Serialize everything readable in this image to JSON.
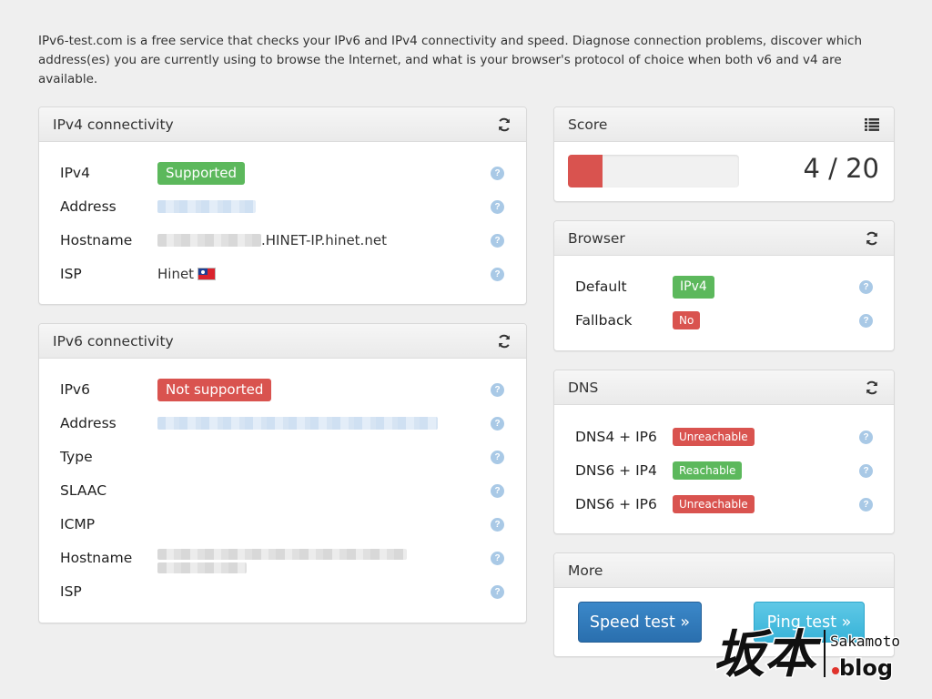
{
  "intro": "IPv6-test.com is a free service that checks your IPv6 and IPv4 connectivity and speed. Diagnose connection problems, discover which address(es) you are currently using to browse the Internet, and what is your browser's protocol of choice when both v6 and v4 are available.",
  "ipv4": {
    "title": "IPv4 connectivity",
    "rows": [
      {
        "label": "IPv4",
        "value": "Supported"
      },
      {
        "label": "Address"
      },
      {
        "label": "Hostname",
        "value": ".HINET-IP.hinet.net"
      },
      {
        "label": "ISP",
        "value": "Hinet"
      }
    ]
  },
  "ipv6": {
    "title": "IPv6 connectivity",
    "rows": [
      {
        "label": "IPv6",
        "value": "Not supported"
      },
      {
        "label": "Address"
      },
      {
        "label": "Type"
      },
      {
        "label": "SLAAC"
      },
      {
        "label": "ICMP"
      },
      {
        "label": "Hostname"
      },
      {
        "label": "ISP"
      }
    ]
  },
  "score": {
    "title": "Score",
    "text": "4 / 20",
    "fraction": 0.2
  },
  "browser": {
    "title": "Browser",
    "rows": [
      {
        "label": "Default",
        "value": "IPv4"
      },
      {
        "label": "Fallback",
        "value": "No"
      }
    ]
  },
  "dns": {
    "title": "DNS",
    "rows": [
      {
        "label": "DNS4 + IP6",
        "value": "Unreachable"
      },
      {
        "label": "DNS6 + IP4",
        "value": "Reachable"
      },
      {
        "label": "DNS6 + IP6",
        "value": "Unreachable"
      }
    ]
  },
  "more": {
    "title": "More",
    "speed_test": "Speed test »",
    "ping_test": "Ping test »"
  },
  "help_glyph": "?",
  "watermark": {
    "brand_cjk": "坂本",
    "brand_latin": "Sakamoto",
    "brand_tld": ".blog"
  },
  "colors": {
    "success": "#5cb85c",
    "danger": "#d9534f",
    "primary": "#337ab7",
    "info": "#5bc0de",
    "help": "#a9c9e6"
  }
}
